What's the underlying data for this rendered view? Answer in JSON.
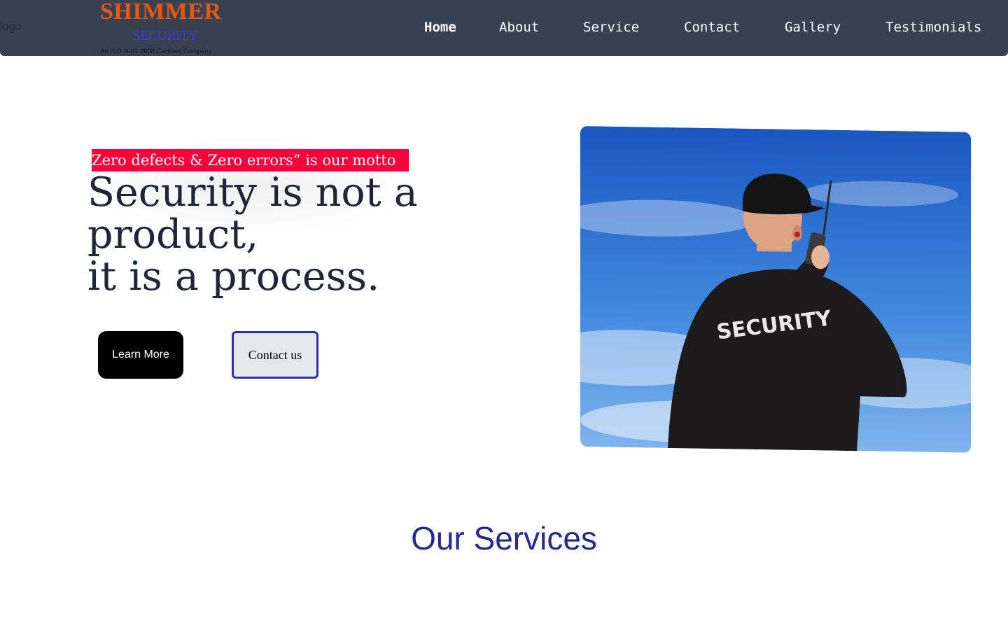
{
  "header": {
    "logo_alt": "logo",
    "brand_name": "SHIMMER",
    "brand_sub": "SECURITY",
    "brand_cert": "An ISO 9001:2008 Certified Company",
    "nav": [
      {
        "label": "Home",
        "active": true
      },
      {
        "label": "About",
        "active": false
      },
      {
        "label": "Service",
        "active": false
      },
      {
        "label": "Contact",
        "active": false
      },
      {
        "label": "Gallery",
        "active": false
      },
      {
        "label": "Testimonials",
        "active": false
      }
    ]
  },
  "hero": {
    "motto": "Zero defects & Zero errors” is our motto",
    "headline_line1": "Security is not a",
    "headline_line2": "product,",
    "headline_line3": "it is a process.",
    "learn_more_label": "Learn More",
    "contact_label": "Contact us",
    "image_text": "SECURITY"
  },
  "services": {
    "title": "Our Services"
  },
  "colors": {
    "nav_bg": "#374151",
    "brand_orange": "#ea580c",
    "brand_blue": "#3b3bd4",
    "motto_bg": "#f9003a",
    "headline": "#1e2638",
    "accent_border": "#2a2fb0",
    "services_title": "#25288c"
  }
}
